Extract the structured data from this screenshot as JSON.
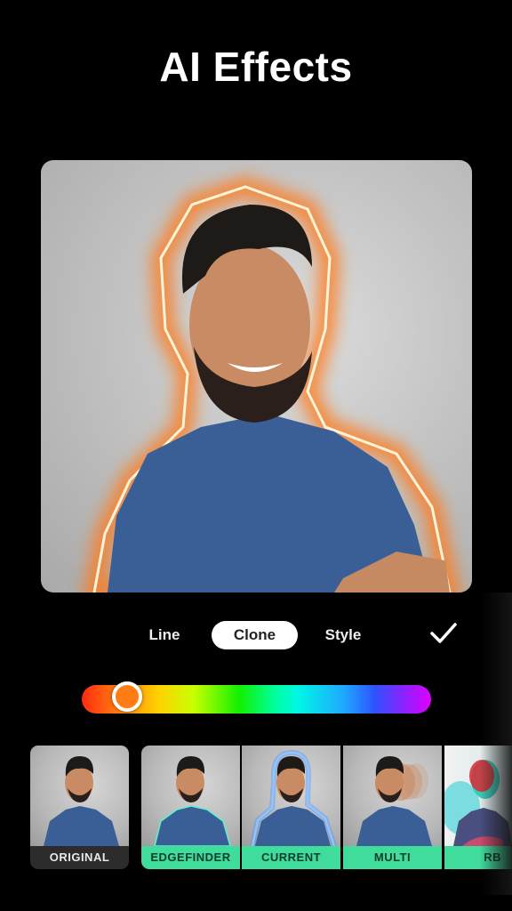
{
  "header": {
    "title": "AI Effects"
  },
  "preview": {
    "effect_glow_color": "#ff7a1e",
    "shirt_color": "#3a5f96",
    "background_color": "#c4c4c4"
  },
  "mode_tabs": [
    {
      "label": "Line",
      "active": false
    },
    {
      "label": "Clone",
      "active": true
    },
    {
      "label": "Style",
      "active": false
    }
  ],
  "confirm": {
    "icon": "checkmark-icon"
  },
  "color_slider": {
    "value_percent": 11,
    "selected_color": "#ff7d14"
  },
  "effects": [
    {
      "label": "ORIGINAL",
      "selected": false
    },
    {
      "label": "EDGEFINDER",
      "selected": false
    },
    {
      "label": "CURRENT",
      "selected": true
    },
    {
      "label": "MULTI",
      "selected": false
    },
    {
      "label": "RB",
      "selected": false
    }
  ],
  "colors": {
    "accent_green": "#3fdc9c",
    "label_dark": "#2c2c2c"
  }
}
